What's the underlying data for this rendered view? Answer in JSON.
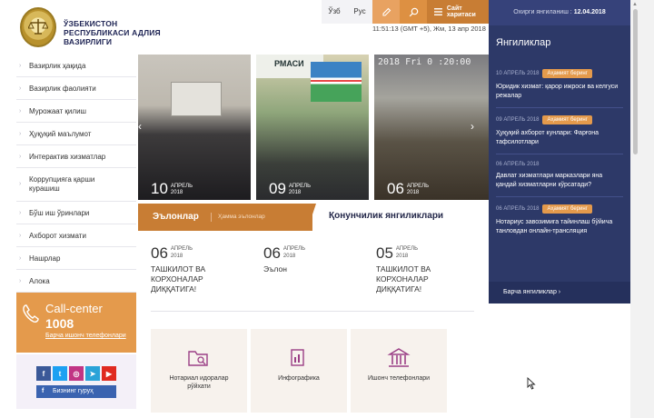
{
  "header": {
    "title": "ЎЗБЕКИСТОН РЕСПУБЛИКАСИ АДЛИЯ ВАЗИРЛИГИ",
    "lang_uz": "Ўзб",
    "lang_ru": "Рус",
    "sitemap": "Сайт харитаси",
    "datetime": "11:51:13 (GMT +5), Жм, 13 апр 2018"
  },
  "right_col": {
    "last_update_label": "Охирги янгиланиш :",
    "last_update_date": "12.04.2018",
    "title": "Янгиликлар",
    "items": [
      {
        "date": "10 АПРЕЛЬ 2018",
        "badge": "Аҳамият беринг",
        "text": "Юридик хизмат: қарор ижроси ва келгуси режалар"
      },
      {
        "date": "09 АПРЕЛЬ 2018",
        "badge": "Аҳамият беринг",
        "text": "Ҳуқуқий ахборот кунлари: Фарғона тафсилотлари"
      },
      {
        "date": "06 АПРЕЛЬ 2018",
        "badge": "",
        "text": "Давлат хизматлари марказлари яна қандай хизматларни кўрсатади?"
      },
      {
        "date": "06 АПРЕЛЬ 2018",
        "badge": "Аҳамият беринг",
        "text": "Нотариус завозимига тайинлаш бўйича танловдан онлайн-трансляция"
      }
    ],
    "all_news": "Барча янгиликлар ›"
  },
  "sidebar": {
    "items": [
      "Вазирлик ҳақида",
      "Вазирлик фаолияти",
      "Мурожаат қилиш",
      "Ҳуқуқий маълумот",
      "Интерактив хизматлар",
      "Коррупцияга қарши курашиш",
      "Бўш иш ўринлари",
      "Ахборот хизмати",
      "Нашрлар",
      "Алока"
    ]
  },
  "call_center": {
    "title": "Call-center",
    "number": "1008",
    "link": "Барча ишонч телефонлари"
  },
  "social": {
    "group_button": "Бизнинг гуруҳ",
    "colors": {
      "facebook": "#3b5998",
      "twitter": "#1da1f2",
      "instagram": "#c13584",
      "telegram": "#2aa3d8",
      "youtube": "#e02a20"
    }
  },
  "photos": [
    {
      "day": "10",
      "month": "АПРЕЛЬ",
      "year": "2018"
    },
    {
      "day": "09",
      "month": "АПРЕЛЬ",
      "year": "2018",
      "banner": "РМАСИ"
    },
    {
      "day": "06",
      "month": "АПРЕЛЬ",
      "year": "2018",
      "stamp": "2018 Fri 0 :20:00"
    }
  ],
  "tabs": {
    "active": "Эълонлар",
    "active_sub": "Ҳамма эълонлар",
    "second": "Қонунчилик янгиликлари"
  },
  "events": [
    {
      "day": "06",
      "month": "АПРЕЛЬ",
      "year": "2018",
      "title": "ТАШКИЛОТ ВА КОРХОНАЛАР ДИҚҚАТИГА!"
    },
    {
      "day": "06",
      "month": "АПРЕЛЬ",
      "year": "2018",
      "title": "Эълон"
    },
    {
      "day": "05",
      "month": "АПРЕЛЬ",
      "year": "2018",
      "title": "ТАШКИЛОТ ВА КОРХОНАЛАР ДИҚҚАТИГА!"
    }
  ],
  "services": [
    {
      "label": "Нотариал идоралар рўйхати"
    },
    {
      "label": "Инфографика"
    },
    {
      "label": "Ишонч телефонлари"
    }
  ],
  "colors": {
    "accent": "#c87d34",
    "navy": "#2d3968",
    "orange": "#e49a4c"
  }
}
